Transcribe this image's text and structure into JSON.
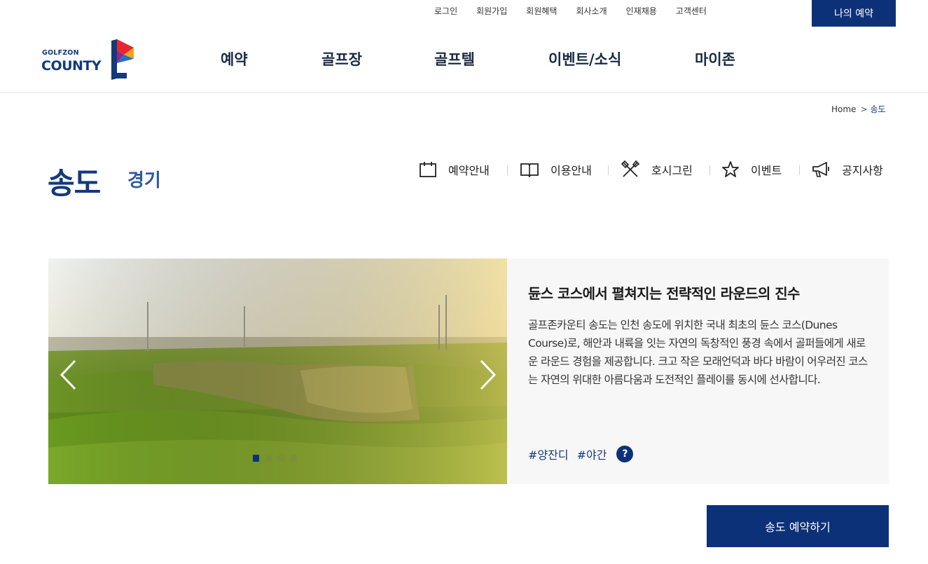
{
  "util": {
    "links": [
      "로그인",
      "회원가입",
      "회원혜택",
      "회사소개",
      "인재채용",
      "고객센터"
    ],
    "my_reservation": "나의 예약"
  },
  "logo": {
    "top": "GOLFZON",
    "bottom": "COUNTY"
  },
  "gnb": [
    "예약",
    "골프장",
    "골프텔",
    "이벤트/소식",
    "마이존"
  ],
  "breadcrumb": {
    "home": "Home",
    "sep": ">",
    "current": "송도"
  },
  "page": {
    "title": "송도",
    "region": "경기"
  },
  "submenu": [
    {
      "label": "예약안내",
      "icon": "calendar-icon"
    },
    {
      "label": "이용안내",
      "icon": "book-icon"
    },
    {
      "label": "호시그린",
      "icon": "utensils-icon"
    },
    {
      "label": "이벤트",
      "icon": "star-icon"
    },
    {
      "label": "공지사항",
      "icon": "megaphone-icon"
    }
  ],
  "intro": {
    "title": "듄스 코스에서 펼쳐지는 전략적인 라운드의 진수",
    "description": "골프존카운티 송도는 인천 송도에 위치한 국내 최초의 듄스 코스(Dunes Course)로, 해안과 내륙을 잇는 자연의 독창적인 풍경 속에서 골퍼들에게 새로운 라운드 경험을 제공합니다. 크고 작은 모래언덕과 바다 바람이 어우러진 코스는 자연의 위대한 아름다움과 도전적인 플레이를 동시에 선사합니다.",
    "tags": [
      "#양잔디",
      "#야간"
    ],
    "help": "?"
  },
  "slider": {
    "count": 4,
    "active": 1
  },
  "book_button": "송도 예약하기",
  "colors": {
    "brand": "#0d3179",
    "title": "#133a7b"
  }
}
